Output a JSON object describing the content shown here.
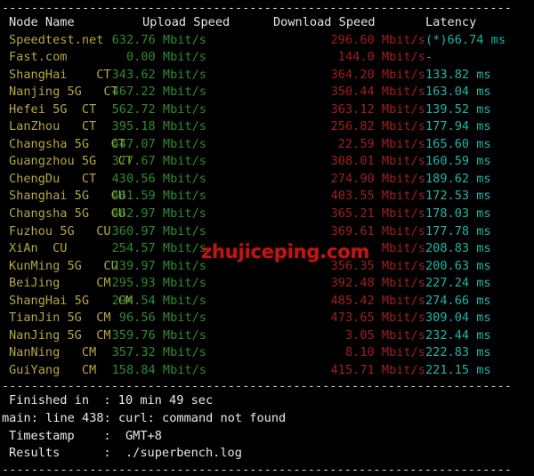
{
  "terminal": {
    "separator_top": "----------------------------------------------------------------------",
    "separator_mid": "----------------------------------------------------------------------",
    "separator_bottom": "----------------------------------------------------------------------",
    "watermark": "zhujiceping.com"
  },
  "table": {
    "headers": {
      "node": "Node Name",
      "upload": "Upload Speed",
      "download": "Download Speed",
      "latency": "Latency"
    },
    "rows": [
      {
        "node": "Speedtest.net",
        "upload": "632.76 Mbit/s",
        "download": "296.60 Mbit/s",
        "latency": "(*)66.74 ms"
      },
      {
        "node": "Fast.com",
        "upload": "0.00 Mbit/s",
        "download": "144.0 Mbit/s",
        "latency": "-"
      },
      {
        "node": "ShangHai    CT",
        "upload": "343.62 Mbit/s",
        "download": "364.20 Mbit/s",
        "latency": "133.82 ms"
      },
      {
        "node": "Nanjing 5G   CT",
        "upload": "467.22 Mbit/s",
        "download": "350.44 Mbit/s",
        "latency": "163.04 ms"
      },
      {
        "node": "Hefei 5G  CT",
        "upload": "562.72 Mbit/s",
        "download": "363.12 Mbit/s",
        "latency": "139.52 ms"
      },
      {
        "node": "LanZhou   CT",
        "upload": "395.18 Mbit/s",
        "download": "256.82 Mbit/s",
        "latency": "177.94 ms"
      },
      {
        "node": "Changsha 5G   CT",
        "upload": "447.07 Mbit/s",
        "download": "22.59 Mbit/s",
        "latency": "165.60 ms"
      },
      {
        "node": "Guangzhou 5G   CT",
        "upload": "377.67 Mbit/s",
        "download": "308.01 Mbit/s",
        "latency": "160.59 ms"
      },
      {
        "node": "ChengDu   CT",
        "upload": "430.56 Mbit/s",
        "download": "274.90 Mbit/s",
        "latency": "189.62 ms"
      },
      {
        "node": "Shanghai 5G   CU",
        "upload": "461.59 Mbit/s",
        "download": "403.55 Mbit/s",
        "latency": "172.53 ms"
      },
      {
        "node": "Changsha 5G   CU",
        "upload": "462.97 Mbit/s",
        "download": "365.21 Mbit/s",
        "latency": "178.03 ms"
      },
      {
        "node": "Fuzhou 5G   CU",
        "upload": "360.97 Mbit/s",
        "download": "369.61 Mbit/s",
        "latency": "177.78 ms"
      },
      {
        "node": "XiAn  CU",
        "upload": "254.57 Mbit/s",
        "download": "Mbit/s",
        "latency": "208.83 ms"
      },
      {
        "node": "KunMing 5G   CU",
        "upload": "239.97 Mbit/s",
        "download": "356.35 Mbit/s",
        "latency": "200.63 ms"
      },
      {
        "node": "BeiJing     CM",
        "upload": "295.93 Mbit/s",
        "download": "392.48 Mbit/s",
        "latency": "227.24 ms"
      },
      {
        "node": "ShangHai 5G    CM",
        "upload": "294.54 Mbit/s",
        "download": "485.42 Mbit/s",
        "latency": "274.66 ms"
      },
      {
        "node": "TianJin 5G  CM",
        "upload": "96.56 Mbit/s",
        "download": "473.65 Mbit/s",
        "latency": "309.04 ms"
      },
      {
        "node": "NanJing 5G  CM",
        "upload": "359.76 Mbit/s",
        "download": "3.05 Mbit/s",
        "latency": "232.44 ms"
      },
      {
        "node": "NanNing   CM",
        "upload": "357.32 Mbit/s",
        "download": "8.10 Mbit/s",
        "latency": "222.83 ms"
      },
      {
        "node": "GuiYang   CM",
        "upload": "158.84 Mbit/s",
        "download": "415.71 Mbit/s",
        "latency": "221.15 ms"
      }
    ]
  },
  "summary": {
    "finished_label": "Finished in  :",
    "finished_value": "10 min 49 sec",
    "error_line": "main: line 438: curl: command not found",
    "timestamp_label": "Timestamp    :",
    "timestamp_value": "GMT+8",
    "results_label": "Results      :",
    "results_value": "./superbench.log"
  }
}
